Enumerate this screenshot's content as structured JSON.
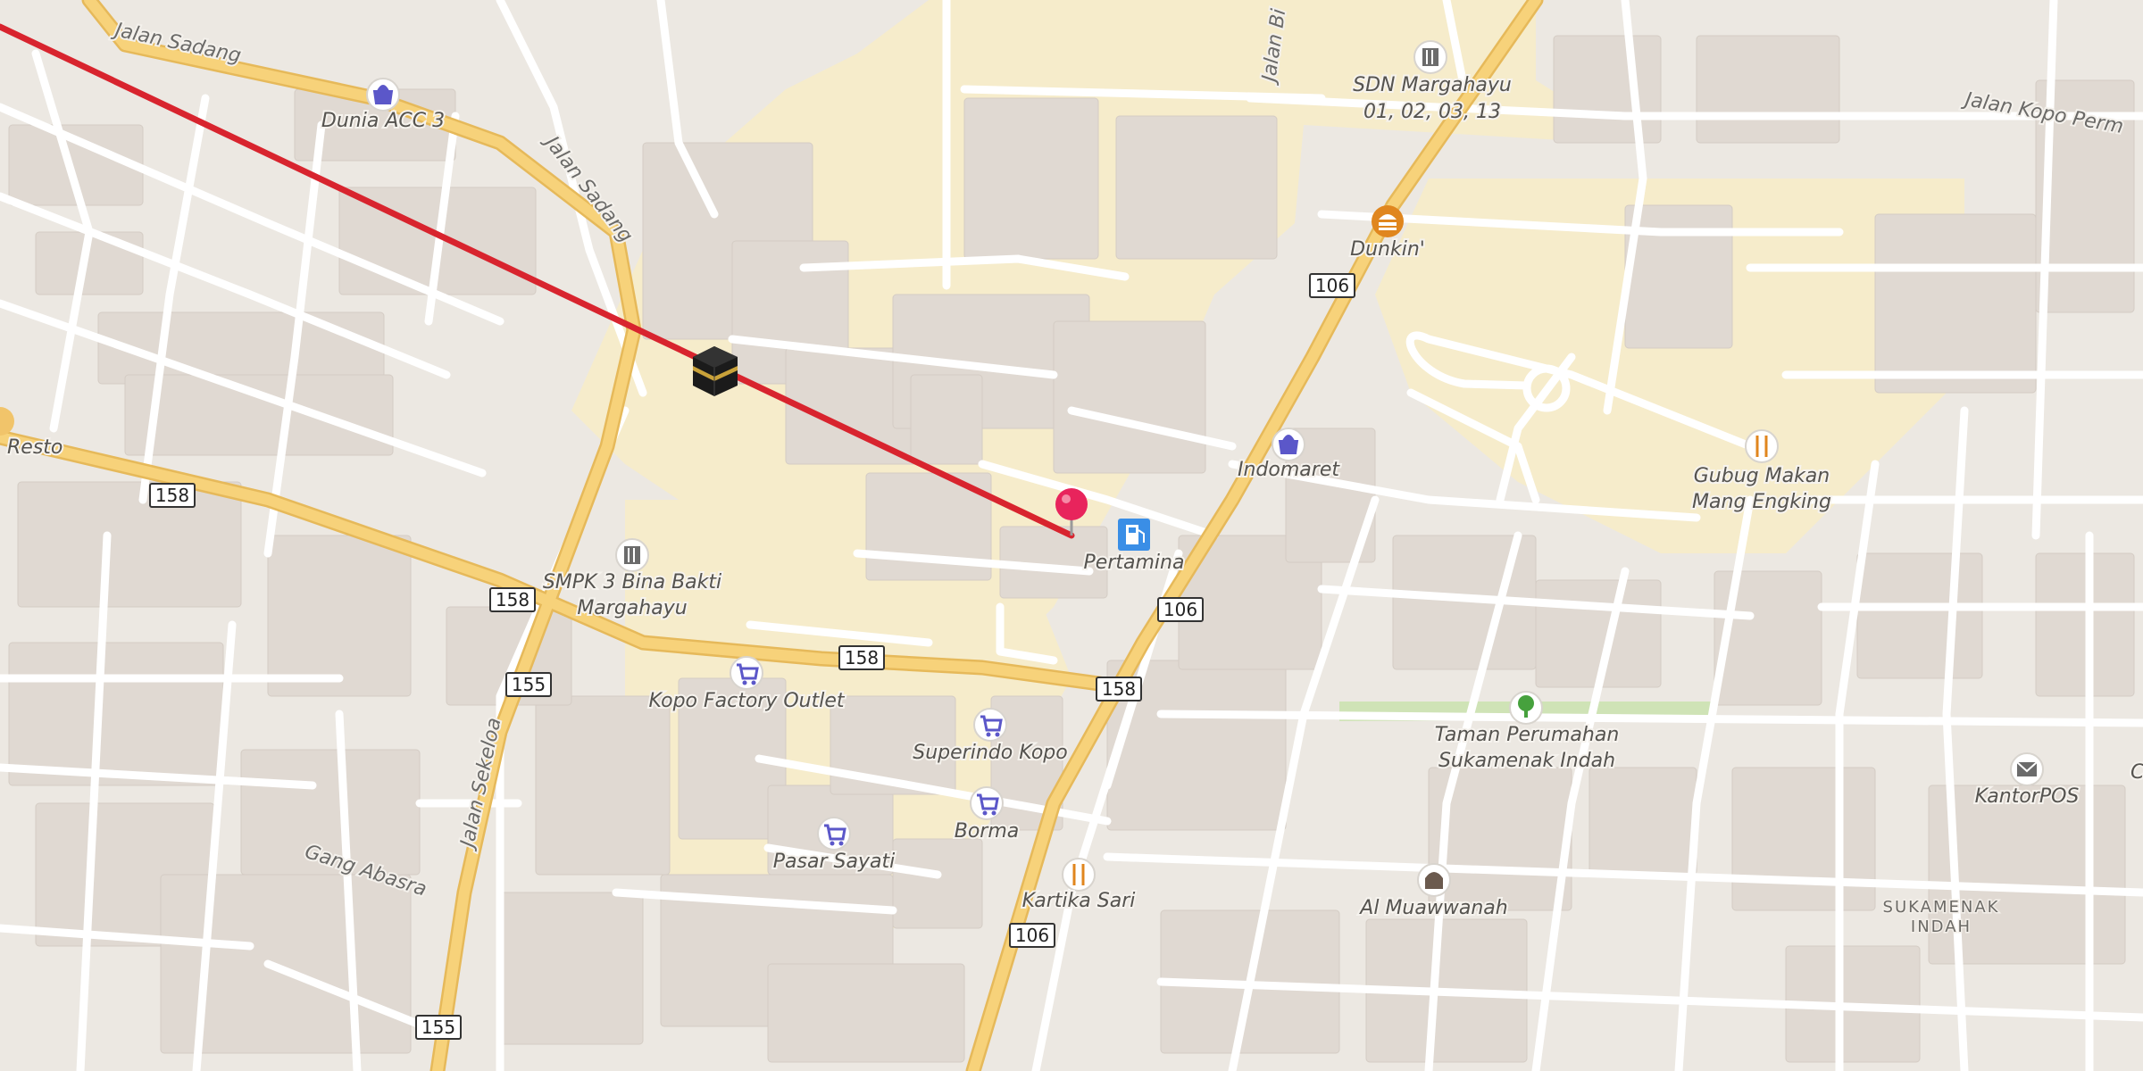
{
  "colors": {
    "background": "#ece8e2",
    "building": "#e0d9d2",
    "minor_road": "#ffffff",
    "major_road": "#f7d27a",
    "major_road_casing": "#e6b95a",
    "land_use_yellow": "#f6eccb",
    "park": "#cfe3b6",
    "route_line": "#d8242e",
    "pin": "#e8245c",
    "poi_shop": "#5b57c9",
    "poi_food": "#e0861e",
    "poi_school": "#6b6b6b",
    "poi_fuel": "#3a8ee6",
    "poi_park": "#46a13d"
  },
  "roads": {
    "jalan_sadang_1": "Jalan Sadang",
    "jalan_sadang_2": "Jalan Sadang",
    "jalan_sekeloa": "Jalan Sekeloa",
    "gang_abasra": "Gang Abasra",
    "jalan_bi": "Jalan Bi",
    "jalan_kopo": "Jalan Kopo Perm"
  },
  "shields": [
    {
      "id": "s158a",
      "text": "158"
    },
    {
      "id": "s158b",
      "text": "158"
    },
    {
      "id": "s158c",
      "text": "158"
    },
    {
      "id": "s158d",
      "text": "158"
    },
    {
      "id": "s155a",
      "text": "155"
    },
    {
      "id": "s155b",
      "text": "155"
    },
    {
      "id": "s106a",
      "text": "106"
    },
    {
      "id": "s106b",
      "text": "106"
    },
    {
      "id": "s106c",
      "text": "106"
    }
  ],
  "pois": [
    {
      "key": "dunia",
      "line1": "Dunia ACC 3",
      "line2": "",
      "icon": "shopping-bag-icon"
    },
    {
      "key": "sdn",
      "line1": "SDN Margahayu",
      "line2": "01, 02, 03, 13",
      "icon": "school-icon"
    },
    {
      "key": "dunkin",
      "line1": "Dunkin'",
      "line2": "",
      "icon": "fast-food-icon"
    },
    {
      "key": "indomaret",
      "line1": "Indomaret",
      "line2": "",
      "icon": "shopping-bag-icon"
    },
    {
      "key": "gubug",
      "line1": "Gubug Makan",
      "line2": "Mang Engking",
      "icon": "restaurant-icon"
    },
    {
      "key": "pertamina",
      "line1": "Pertamina",
      "line2": "",
      "icon": "fuel-icon"
    },
    {
      "key": "smpk",
      "line1": "SMPK 3 Bina Bakti",
      "line2": "Margahayu",
      "icon": "school-icon"
    },
    {
      "key": "kopo_factory",
      "line1": "Kopo Factory Outlet",
      "line2": "",
      "icon": "shopping-cart-icon"
    },
    {
      "key": "superindo",
      "line1": "Superindo Kopo",
      "line2": "",
      "icon": "shopping-cart-icon"
    },
    {
      "key": "borma",
      "line1": "Borma",
      "line2": "",
      "icon": "shopping-cart-icon"
    },
    {
      "key": "pasar",
      "line1": "Pasar Sayati",
      "line2": "",
      "icon": "shopping-cart-icon"
    },
    {
      "key": "kartika",
      "line1": "Kartika Sari",
      "line2": "",
      "icon": "restaurant-icon"
    },
    {
      "key": "taman",
      "line1": "Taman Perumahan",
      "line2": "Sukamenak Indah",
      "icon": "park-tree-icon"
    },
    {
      "key": "kantorpos",
      "line1": "KantorPOS",
      "line2": "",
      "icon": "post-office-icon"
    },
    {
      "key": "chopp",
      "line1": "Chopp",
      "line2": "",
      "icon": ""
    },
    {
      "key": "almuawwanah",
      "line1": "Al Muawwanah",
      "line2": "",
      "icon": "mosque-icon"
    },
    {
      "key": "resto",
      "line1": "Resto",
      "line2": "",
      "icon": "restaurant-icon"
    }
  ],
  "area": {
    "line1": "SUKAMENAK",
    "line2": "INDAH"
  },
  "markers": {
    "destination": "kaaba-icon",
    "current_location": "location-pin-icon",
    "route": "qibla-direction-line"
  }
}
